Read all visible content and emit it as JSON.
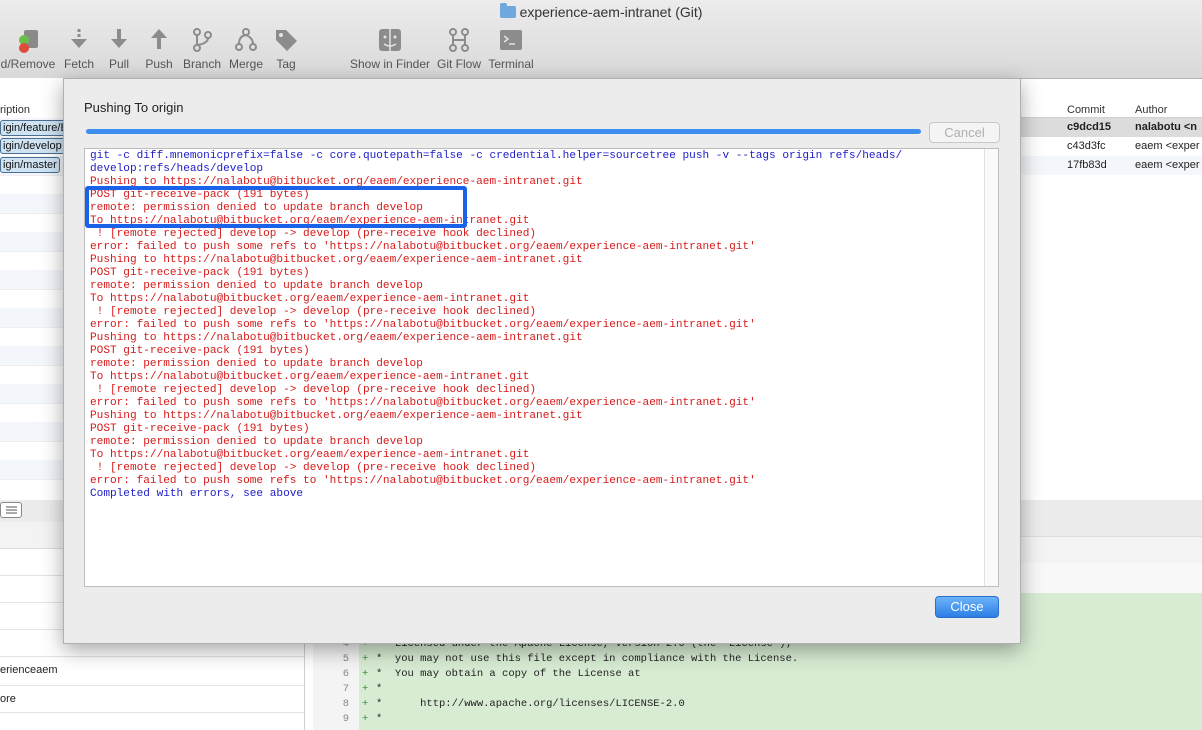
{
  "window": {
    "title": "experience-aem-intranet (Git)"
  },
  "toolbar": {
    "items": [
      {
        "label": "d/Remove"
      },
      {
        "label": "Fetch"
      },
      {
        "label": "Pull"
      },
      {
        "label": "Push"
      },
      {
        "label": "Branch"
      },
      {
        "label": "Merge"
      },
      {
        "label": "Tag"
      },
      {
        "label": "Show in Finder"
      },
      {
        "label": "Git Flow"
      },
      {
        "label": "Terminal"
      }
    ]
  },
  "history": {
    "description_header": "ription",
    "commit_header": "Commit",
    "author_header": "Author",
    "branch_tags": [
      "igin/feature/E",
      "igin/develop",
      "igin/master"
    ],
    "commits": [
      {
        "hash": "c9dcd15",
        "author": "nalabotu <n"
      },
      {
        "hash": "c43d3fc",
        "author": "eaem <exper"
      },
      {
        "hash": "17fb83d",
        "author": "eaem <exper"
      }
    ]
  },
  "dialog": {
    "title": "Pushing To origin",
    "progress": 1.0,
    "cancel_label": "Cancel",
    "close_label": "Close",
    "log": [
      {
        "text": "git -c diff.mnemonicprefix=false -c core.quotepath=false -c credential.helper=sourcetree push -v --tags origin refs/heads/",
        "color": "blue"
      },
      {
        "text": "develop:refs/heads/develop",
        "color": "blue"
      },
      {
        "text": "Pushing to https://nalabotu@bitbucket.org/eaem/experience-aem-intranet.git",
        "color": "red"
      },
      {
        "text": "POST git-receive-pack (191 bytes)",
        "color": "red"
      },
      {
        "text": "remote: permission denied to update branch develop",
        "color": "red"
      },
      {
        "text": "To https://nalabotu@bitbucket.org/eaem/experience-aem-intranet.git",
        "color": "red"
      },
      {
        "text": " ! [remote rejected] develop -> develop (pre-receive hook declined)",
        "color": "red"
      },
      {
        "text": "error: failed to push some refs to 'https://nalabotu@bitbucket.org/eaem/experience-aem-intranet.git'",
        "color": "red"
      },
      {
        "text": "Pushing to https://nalabotu@bitbucket.org/eaem/experience-aem-intranet.git",
        "color": "red"
      },
      {
        "text": "POST git-receive-pack (191 bytes)",
        "color": "red"
      },
      {
        "text": "remote: permission denied to update branch develop",
        "color": "red"
      },
      {
        "text": "To https://nalabotu@bitbucket.org/eaem/experience-aem-intranet.git",
        "color": "red"
      },
      {
        "text": " ! [remote rejected] develop -> develop (pre-receive hook declined)",
        "color": "red"
      },
      {
        "text": "error: failed to push some refs to 'https://nalabotu@bitbucket.org/eaem/experience-aem-intranet.git'",
        "color": "red"
      },
      {
        "text": "Pushing to https://nalabotu@bitbucket.org/eaem/experience-aem-intranet.git",
        "color": "red"
      },
      {
        "text": "POST git-receive-pack (191 bytes)",
        "color": "red"
      },
      {
        "text": "remote: permission denied to update branch develop",
        "color": "red"
      },
      {
        "text": "To https://nalabotu@bitbucket.org/eaem/experience-aem-intranet.git",
        "color": "red"
      },
      {
        "text": " ! [remote rejected] develop -> develop (pre-receive hook declined)",
        "color": "red"
      },
      {
        "text": "error: failed to push some refs to 'https://nalabotu@bitbucket.org/eaem/experience-aem-intranet.git'",
        "color": "red"
      },
      {
        "text": "Pushing to https://nalabotu@bitbucket.org/eaem/experience-aem-intranet.git",
        "color": "red"
      },
      {
        "text": "POST git-receive-pack (191 bytes)",
        "color": "red"
      },
      {
        "text": "remote: permission denied to update branch develop",
        "color": "red"
      },
      {
        "text": "To https://nalabotu@bitbucket.org/eaem/experience-aem-intranet.git",
        "color": "red"
      },
      {
        "text": " ! [remote rejected] develop -> develop (pre-receive hook declined)",
        "color": "red"
      },
      {
        "text": "error: failed to push some refs to 'https://nalabotu@bitbucket.org/eaem/experience-aem-intranet.git'",
        "color": "red"
      },
      {
        "text": "Completed with errors, see above",
        "color": "blue"
      }
    ]
  },
  "file_list": {
    "items": [
      "erienceaem",
      "ore"
    ]
  },
  "diff": {
    "lines": [
      {
        "num": "4",
        "marker": "+",
        "code": "*  Licensed under the Apache License, Version 2.0 (the \"License\");"
      },
      {
        "num": "5",
        "marker": "+",
        "code": "*  you may not use this file except in compliance with the License."
      },
      {
        "num": "6",
        "marker": "+",
        "code": "*  You may obtain a copy of the License at"
      },
      {
        "num": "7",
        "marker": "+",
        "code": "*"
      },
      {
        "num": "8",
        "marker": "+",
        "code": "*      http://www.apache.org/licenses/LICENSE-2.0"
      },
      {
        "num": "9",
        "marker": "+",
        "code": "*"
      }
    ]
  },
  "colors": {
    "accent": "#3d8ef0",
    "highlight": "#1a62e8",
    "error": "#d61a1a",
    "info": "#2020c8",
    "diff_added": "#d8ecd3"
  }
}
